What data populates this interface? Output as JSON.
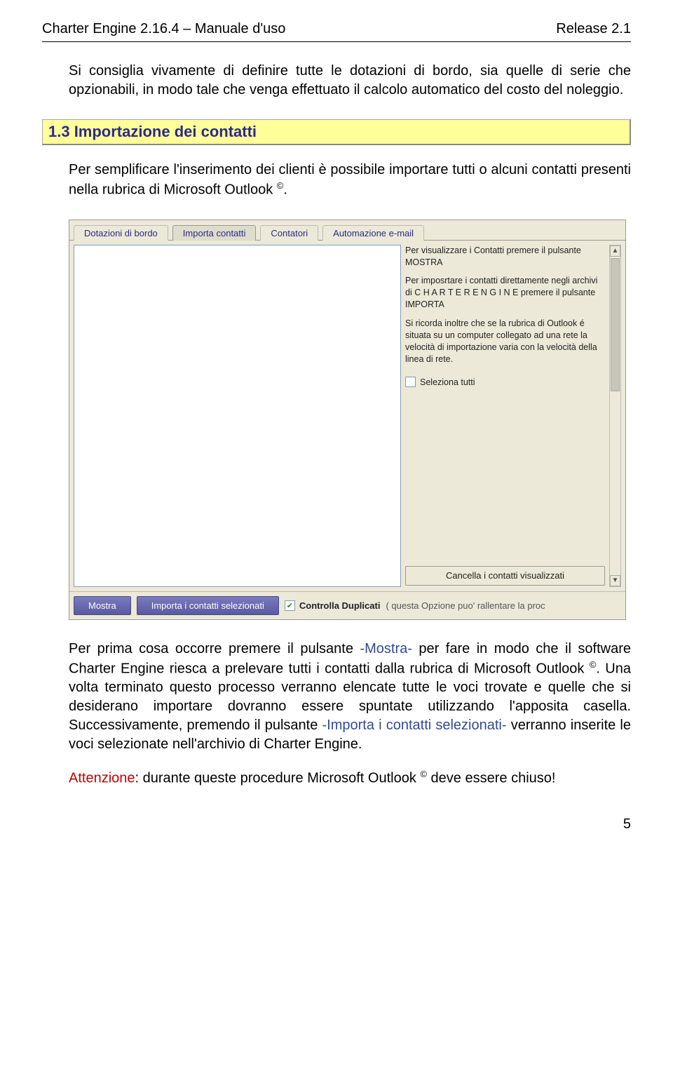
{
  "header": {
    "left": "Charter Engine 2.16.4 – Manuale d'uso",
    "right": "Release 2.1"
  },
  "intro_paragraph": "Si consiglia vivamente di definire tutte le dotazioni di bordo, sia quelle di serie che opzionabili, in modo tale che venga effettuato il calcolo automatico del costo del noleggio.",
  "section_heading": "1.3   Importazione dei contatti",
  "section_para_pre": "Per semplificare l'inserimento dei clienti è possibile importare tutti o alcuni contatti presenti nella rubrica di Microsoft Outlook ",
  "section_para_sup": "©",
  "section_para_post": ".",
  "screenshot": {
    "tabs": [
      {
        "label": "Dotazioni di bordo",
        "active": false
      },
      {
        "label": "Importa contatti",
        "active": true
      },
      {
        "label": "Contatori",
        "active": false
      },
      {
        "label": "Automazione e-mail",
        "active": false
      }
    ],
    "side_texts": [
      "Per visualizzare i Contatti premere il pulsante MOSTRA",
      "Per imposrtare i contatti direttamente negli archivi di C H A R T E R  E N G I N E premere il pulsante IMPORTA",
      "Si ricorda inoltre che se la rubrica di Outlook é situata su un computer collegato ad una rete la velocità di importazione varia con la velocità della linea di rete."
    ],
    "select_all_label": "Seleziona tutti",
    "cancel_button_label": "Cancella i contatti visualizzati",
    "footer_buttons": {
      "mostra": "Mostra",
      "importa": "Importa i contatti selezionati"
    },
    "dup_check_label": "Controlla Duplicati",
    "dup_note": "( questa Opzione puo' rallentare la proc"
  },
  "para2": {
    "p1_pre": "Per prima cosa occorre premere il pulsante ",
    "p1_hl1": "-Mostra-",
    "p1_mid": " per fare in modo che il software Charter Engine riesca a prelevare tutti i contatti dalla rubrica di Microsoft Outlook ",
    "p1_sup": "©",
    "p1_post": ". Una volta terminato questo processo verranno elencate tutte le voci trovate e quelle che si desiderano importare dovranno essere spuntate utilizzando l'apposita casella. Successivamente, premendo il pulsante ",
    "p1_hl2": "-Importa i contatti selezionati-",
    "p1_end": " verranno inserite le voci selezionate nell'archivio di Charter Engine.",
    "warn_label": "Attenzione",
    "warn_text_pre": ": durante queste procedure Microsoft Outlook ",
    "warn_sup": "©",
    "warn_text_post": " deve essere chiuso!"
  },
  "page_number": "5"
}
